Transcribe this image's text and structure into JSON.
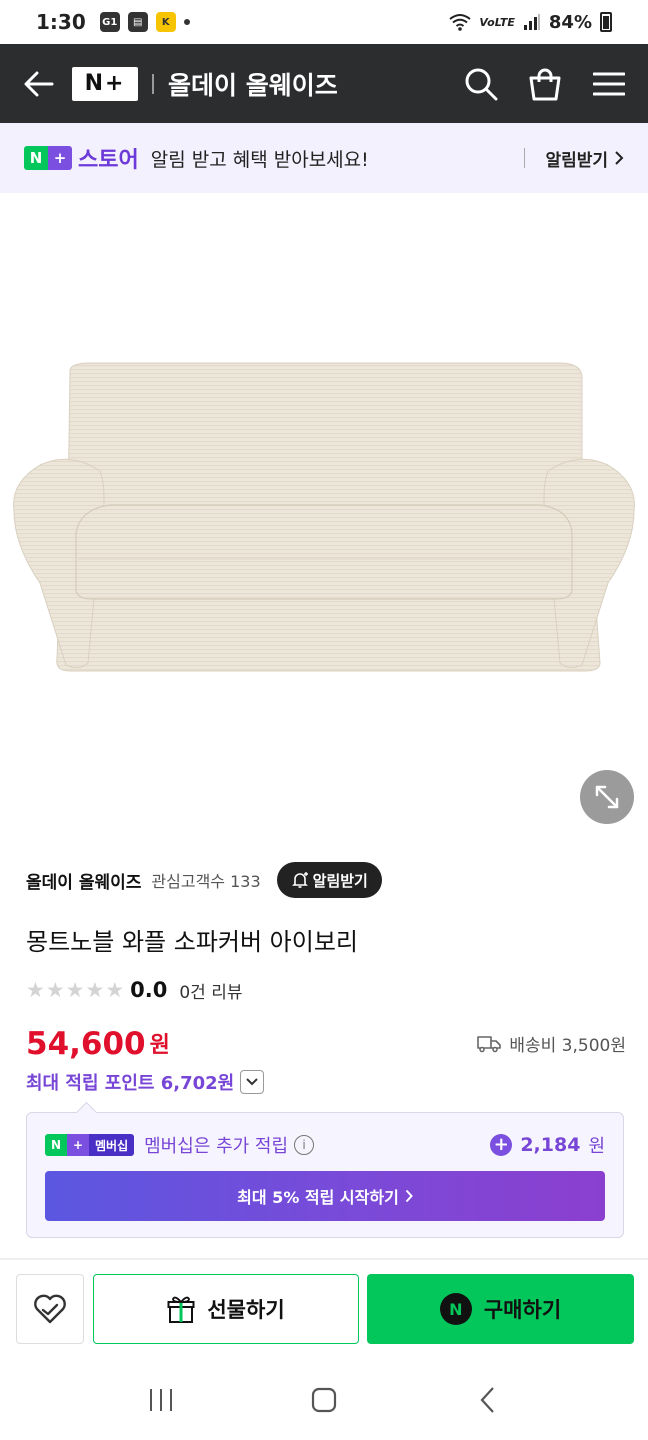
{
  "status": {
    "time": "1:30",
    "battery": "84%",
    "notification_icons": [
      "G1",
      "",
      "K"
    ]
  },
  "header": {
    "logo": "N+",
    "store_name": "올데이 올웨이즈"
  },
  "promo": {
    "store_label": "스토어",
    "message": "알림 받고 혜택 받아보세요!",
    "link": "알림받기"
  },
  "seller": {
    "name": "올데이 올웨이즈",
    "followers": "관심고객수 133",
    "alarm_button": "알림받기"
  },
  "product": {
    "title": "몽트노블 와플 소파커버 아이보리",
    "rating": "0.0",
    "review_count": "0건 리뷰",
    "price": "54,600",
    "price_unit": "원",
    "shipping": "배송비 3,500원",
    "max_points": "최대 적립 포인트 6,702원"
  },
  "membership": {
    "badge_n": "N",
    "badge_plus": "+",
    "badge_label": "멤버십",
    "text": "멤버십은 추가 적립",
    "points": "2,184",
    "points_unit": "원",
    "cta": "최대 5% 적립 시작하기"
  },
  "actions": {
    "gift": "선물하기",
    "buy": "구매하기",
    "npay_letter": "N"
  },
  "colors": {
    "header_bg": "#2b2d2f",
    "naver_green": "#03c75a",
    "purple": "#7846d6",
    "price_red": "#e0102c"
  }
}
